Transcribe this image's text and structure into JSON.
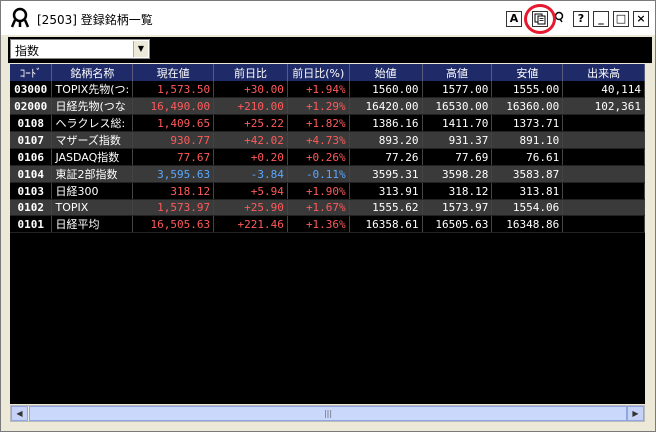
{
  "window": {
    "title": "[2503] 登録銘柄一覧",
    "controls": {
      "font_btn": "A",
      "copy_btn": "copy-icon",
      "search_btn": "search-icon",
      "help_btn": "?",
      "minimize_btn": "_",
      "maximize_btn": "□",
      "close_btn": "×"
    }
  },
  "selector": {
    "value": "指数"
  },
  "table": {
    "columns": [
      "ｺｰﾄﾞ",
      "銘柄名称",
      "現在値",
      "前日比",
      "前日比(%)",
      "始値",
      "高値",
      "安値",
      "出来高"
    ],
    "rows": [
      {
        "code": "03000",
        "name": "TOPIX先物(つ:",
        "price": "1,573.50",
        "change": "+30.00",
        "pct": "+1.94%",
        "open": "1560.00",
        "high": "1577.00",
        "low": "1555.00",
        "volume": "40,114",
        "dir": "up"
      },
      {
        "code": "02000",
        "name": "日経先物(つな",
        "price": "16,490.00",
        "change": "+210.00",
        "pct": "+1.29%",
        "open": "16420.00",
        "high": "16530.00",
        "low": "16360.00",
        "volume": "102,361",
        "dir": "up"
      },
      {
        "code": "0108",
        "name": "ヘラクレス総:",
        "price": "1,409.65",
        "change": "+25.22",
        "pct": "+1.82%",
        "open": "1386.16",
        "high": "1411.70",
        "low": "1373.71",
        "volume": "",
        "dir": "up"
      },
      {
        "code": "0107",
        "name": "マザーズ指数",
        "price": "930.77",
        "change": "+42.02",
        "pct": "+4.73%",
        "open": "893.20",
        "high": "931.37",
        "low": "891.10",
        "volume": "",
        "dir": "up"
      },
      {
        "code": "0106",
        "name": "JASDAQ指数",
        "price": "77.67",
        "change": "+0.20",
        "pct": "+0.26%",
        "open": "77.26",
        "high": "77.69",
        "low": "76.61",
        "volume": "",
        "dir": "up"
      },
      {
        "code": "0104",
        "name": "東証2部指数",
        "price": "3,595.63",
        "change": "-3.84",
        "pct": "-0.11%",
        "open": "3595.31",
        "high": "3598.28",
        "low": "3583.87",
        "volume": "",
        "dir": "down"
      },
      {
        "code": "0103",
        "name": "日経300",
        "price": "318.12",
        "change": "+5.94",
        "pct": "+1.90%",
        "open": "313.91",
        "high": "318.12",
        "low": "313.81",
        "volume": "",
        "dir": "up"
      },
      {
        "code": "0102",
        "name": "TOPIX",
        "price": "1,573.97",
        "change": "+25.90",
        "pct": "+1.67%",
        "open": "1555.62",
        "high": "1573.97",
        "low": "1554.06",
        "volume": "",
        "dir": "up"
      },
      {
        "code": "0101",
        "name": "日経平均",
        "price": "16,505.63",
        "change": "+221.46",
        "pct": "+1.36%",
        "open": "16358.61",
        "high": "16505.63",
        "low": "16348.86",
        "volume": "",
        "dir": "up"
      }
    ]
  },
  "scrollbar": {
    "left_arrow": "◀",
    "right_arrow": "▶",
    "grip": "|||"
  }
}
